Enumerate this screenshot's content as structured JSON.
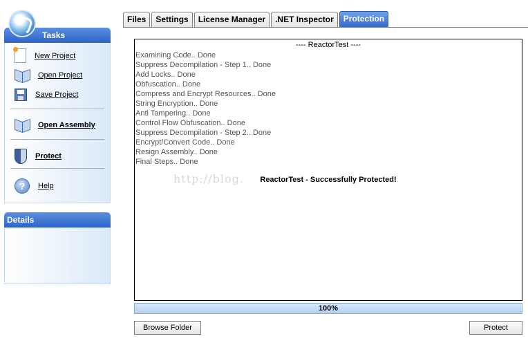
{
  "sidebar": {
    "tasks_title": "Tasks",
    "tasks": [
      {
        "label": "New Project",
        "icon": "new-project-icon"
      },
      {
        "label": "Open Project",
        "icon": "open-project-icon"
      },
      {
        "label": "Save Project",
        "icon": "save-project-icon"
      },
      {
        "label": "Open Assembly",
        "icon": "open-assembly-icon"
      },
      {
        "label": "Protect",
        "icon": "shield-icon"
      },
      {
        "label": "Help",
        "icon": "help-icon"
      }
    ],
    "details_title": "Details"
  },
  "tabs": [
    {
      "label": "Files",
      "active": false
    },
    {
      "label": "Settings",
      "active": false
    },
    {
      "label": "License Manager",
      "active": false
    },
    {
      "label": ".NET Inspector",
      "active": false
    },
    {
      "label": "Protection",
      "active": true
    }
  ],
  "log": {
    "title": "---- ReactorTest ----",
    "lines": [
      "Examining Code.. Done",
      "Suppress Decompilation - Step 1.. Done",
      "Add Locks.. Done",
      "Obfuscation.. Done",
      "Compress and Encrypt Resources.. Done",
      "String Encryption.. Done",
      "Anti Tampering.. Done",
      "Control Flow Obfuscation.. Done",
      "Suppress Decompilation - Step 2.. Done",
      "Encrypt/Convert Code.. Done",
      "Resign Assembly.. Done",
      "Final Steps.. Done"
    ],
    "result": "ReactorTest - Successfully Protected!",
    "watermark": "http://blog."
  },
  "progress": {
    "value": 100,
    "label": "100%"
  },
  "buttons": {
    "browse_folder": "Browse Folder",
    "protect": "Protect"
  },
  "colors": {
    "accent": "#3268c9",
    "panel": "#dbe9f9"
  }
}
